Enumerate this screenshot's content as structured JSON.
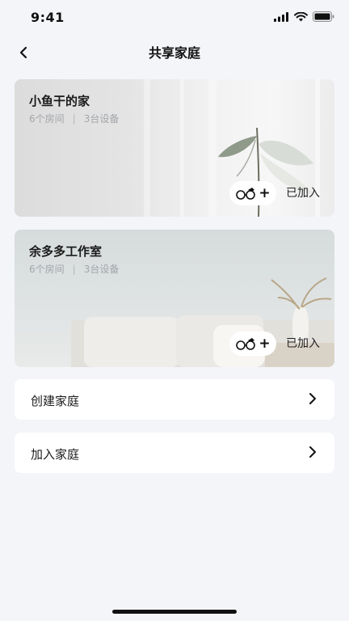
{
  "status_bar": {
    "time": "9:41"
  },
  "nav": {
    "title": "共享家庭"
  },
  "families": [
    {
      "name": "小鱼干的家",
      "rooms": "6个房间",
      "devices": "3台设备",
      "status": "已加入"
    },
    {
      "name": "余多多工作室",
      "rooms": "6个房间",
      "devices": "3台设备",
      "status": "已加入"
    }
  ],
  "actions": [
    {
      "label": "创建家庭"
    },
    {
      "label": "加入家庭"
    }
  ],
  "colors": {
    "background": "#f4f5f9",
    "card_white": "#ffffff",
    "muted_text": "#a3a6aa"
  }
}
